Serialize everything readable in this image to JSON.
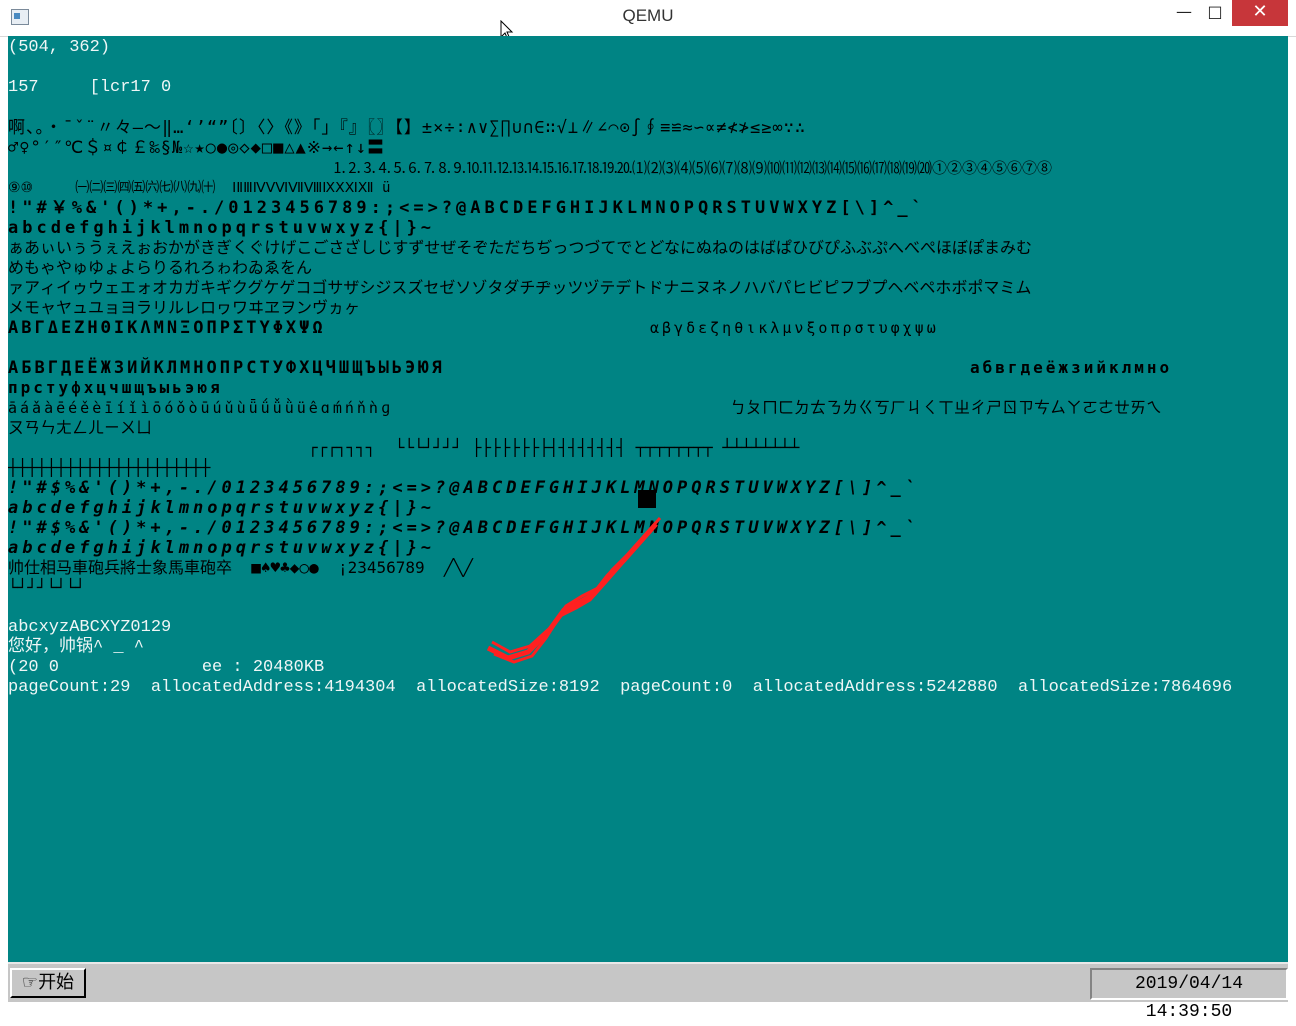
{
  "window": {
    "title": "QEMU",
    "minimize": "—",
    "maximize": "□",
    "close": "✕",
    "icon": "qemu-app-icon"
  },
  "screen": {
    "background": "#008484",
    "coord_readout": "(504, 362)",
    "counter_line": "157     [lcr17 0",
    "charset_rows": [
      "啊、。・ˉˇ¨〃々—～‖…‘’“”〔〕〈〉《》「」『』〖〗【】±×÷∶∧∨∑∏∪∩∈∷√⊥∥∠⌒⊙∫∮≡≌≈∽∝≠≮≯≤≥∞∵∴",
      "♂♀°′″℃＄¤￠￡‰§№☆★○●◎◇◆□■△▲※→←↑↓〓",
      "⒈⒉⒊⒋⒌⒍⒎⒏⒐⒑⒒⒓⒔⒕⒖⒗⒘⒙⒚⒛⑴⑵⑶⑷⑸⑹⑺⑻⑼⑽⑾⑿⒀⒁⒂⒃⒄⒅⒆⒇①②③④⑤⑥⑦⑧",
      "⑨⑩     ㈠㈡㈢㈣㈤㈥㈦㈧㈨㈩  ⅠⅡⅢⅣⅤⅥⅦⅧⅨⅩⅪⅫ ü",
      "!\"#￥%&'()*+,-./0123456789:;<=>?@ABCDEFGHIJKLMNOPQRSTUVWXYZ[\\]^_`",
      "abcdefghijklmnopqrstuvwxyz{|}~",
      "ぁあぃいぅうぇえぉおかがきぎくぐけげこごさざしじすずせぜそぞただちぢっつづてでとどなにぬねのはばぱひびぴふぶぷへべぺほぼぽまみむ",
      "めもゃやゅゆょよらりるれろゎわゐゑをん",
      "ァアィイゥウェエォオカガキギクグケゲコゴサザシジスズセゼソゾタダチヂッツヅテデトドナニヌネノハバパヒビピフブプヘベペホボポマミム",
      "メモャヤュユョヨラリルレロヮワヰヱヲンヴヵヶ",
      "ΑΒΓΔΕΖΗΘΙΚΛΜΝΞΟΠΡΣΤΥΦΧΨΩ",
      "αβγδεζηθικλμνξοπρστυφχψω",
      "АБВГДЕЁЖЗИЙКЛМНОПРСТУФХЦЧШЩЪЫЬЭЮЯ",
      "абвгдеёжзийклмно",
      "прстуфхцчшщъыьэюя",
      "āáǎàēéěèīíǐìōóǒòūúǔùǖǘǚǜüêɑḿńňǹɡ",
      "ㄅㄆㄇㄈㄉㄊㄋㄌㄍㄎㄏㄐㄑㄒㄓㄔㄕㄖㄗㄘㄙㄚㄛㄜㄝㄞㄟ",
      "ㄡㄢㄣㄤㄥㄦㄧㄨㄩ",
      "┌┌┌┐┐┐┐  └└└┘┘┘┘ ├├├├├├├├┤┤┤┤┤┤┤┤ ┬┬┬┬┬┬┬┬ ┴┴┴┴┴┴┴┴",
      "┼┼┼┼┼┼┼┼┼┼┼┼┼┼┼┼┼┼┼┼┼",
      "!\"#$%&'()*+,-./0123456789:;<=>?@ABCDEFGHIJKLMNOPQRSTUVWXYZ[\\]^_`",
      "abcdefghijklmnopqrstuvwxyz{|}~",
      "!\"#$%&'()*+,-./0123456789:;<=>?@ABCDEFGHIJKLMNOPQRSTUVWXYZ[\\]^_`",
      "abcdefghijklmnopqrstuvwxyz{|}~",
      "帅仕相马車砲兵將士象馬車砲卒  ■♠♥♣◆○●  ¡23456789  ╱╲╱",
      "└┘┘┘└┘└┘"
    ],
    "text_line_1": "abcxyzABCXYZ0129",
    "text_line_2": "您好，帅锅^ _ ^",
    "text_line_3": "(20 0              ee : 20480KB",
    "text_line_4": "pageCount:29  allocatedAddress:4194304  allocatedSize:8192  pageCount:0  allocatedAddress:5242880  allocatedSize:7864696"
  },
  "taskbar": {
    "start_label": "开始",
    "start_icon": "start-icon",
    "clock": "2019/04/14 14:39:50"
  },
  "colors": {
    "screen_bg": "#008484",
    "snake": "#ff2020",
    "taskbar": "#c6c6c6",
    "close_button": "#c7363a"
  }
}
